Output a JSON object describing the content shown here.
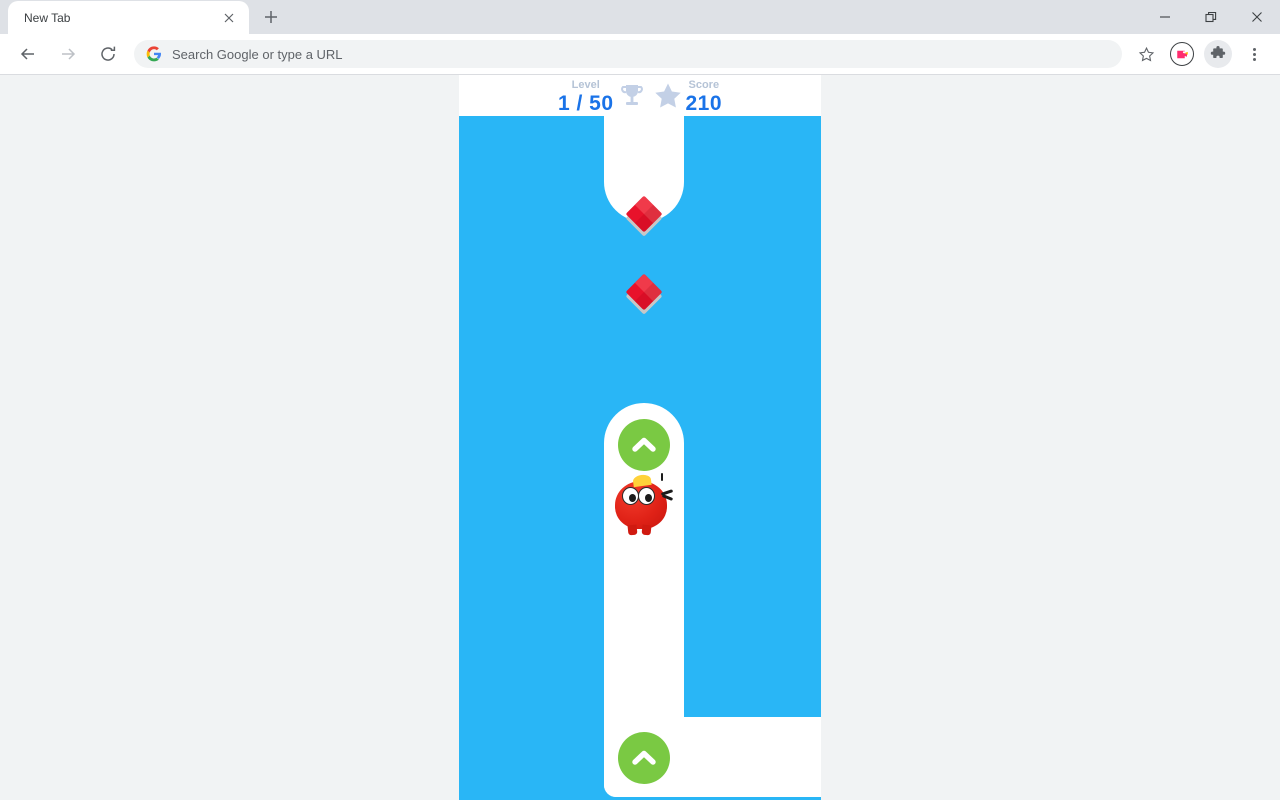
{
  "browser": {
    "tab": {
      "title": "New Tab",
      "close_icon": "close-icon"
    },
    "new_tab_icon": "plus-icon",
    "window_controls": {
      "minimize": "minimize-icon",
      "maximize": "maximize-icon",
      "close": "close-icon"
    },
    "toolbar": {
      "back_icon": "back-arrow-icon",
      "forward_icon": "forward-arrow-icon",
      "reload_icon": "reload-icon",
      "omnibox_placeholder": "Search Google or type a URL",
      "omnibox_value": "",
      "google_icon": "google-g-icon",
      "bookmark_icon": "star-icon",
      "extension_icon": "pink-extension-icon",
      "extensions_icon": "puzzle-piece-icon",
      "menu_icon": "three-dot-menu-icon"
    }
  },
  "game": {
    "hud": {
      "level_label": "Level",
      "level_value": "1 / 50",
      "trophy_icon": "trophy-icon",
      "star_icon": "star-icon",
      "score_label": "Score",
      "score_value": "210"
    },
    "colors": {
      "background": "#29b6f6",
      "path": "#ffffff",
      "button": "#7ac943",
      "gem": "#e8122b",
      "hud_value": "#1a73e8",
      "hud_label": "#b5c3d6",
      "character": "#e02217"
    },
    "gems": [
      {
        "name": "gem-collectible-1"
      },
      {
        "name": "gem-collectible-2"
      }
    ],
    "arrow_buttons": [
      {
        "name": "jump-arrow-upper",
        "icon": "chevron-up-icon"
      },
      {
        "name": "jump-arrow-lower",
        "icon": "chevron-up-icon"
      }
    ],
    "character": {
      "name": "player-character"
    }
  }
}
